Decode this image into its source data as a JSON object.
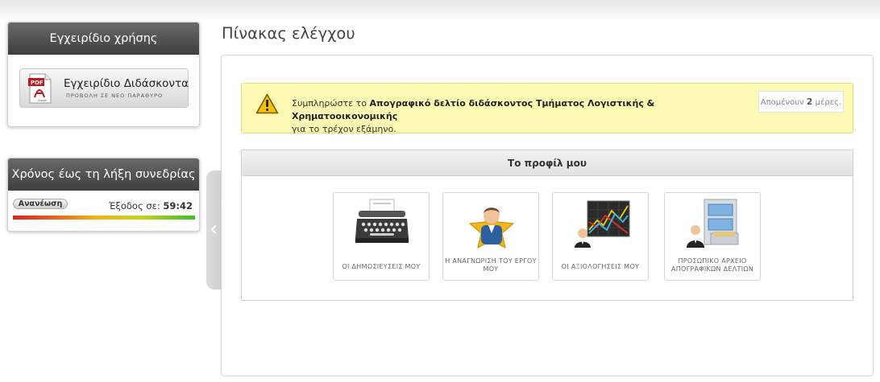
{
  "sidebar": {
    "manual_panel": {
      "title": "Εγχειρίδιο χρήσης",
      "button_title": "Εγχειρίδιο Διδάσκοντα",
      "button_subtitle": "ΠΡΟΒΟΛΗ ΣΕ ΝΕΟ ΠΑΡΑΘΥΡΟ",
      "pdf_label": "PDF",
      "pdf_brand": "Adobe"
    },
    "session_panel": {
      "title": "Χρόνος έως τη λήξη συνεδρίας",
      "refresh_label": "Ανανέωση",
      "exit_prefix": "Έξοδος σε:",
      "exit_time": "59:42"
    },
    "collapse_glyph": "‹"
  },
  "main": {
    "page_title": "Πίνακας ελέγχου",
    "alert": {
      "text_prefix": "Συμπληρώστε το ",
      "text_bold": "Απογραφικό δελτίο διδάσκοντος Τμήματος Λογιστικής & Χρηματοοικονομικής",
      "text_suffix": "για το τρέχον εξάμηνο.",
      "days_prefix": "Απομένουν ",
      "days_value": "2",
      "days_suffix": " μέρες.",
      "icon": "warning-icon"
    },
    "profile": {
      "title": "Το προφίλ μου",
      "tiles": [
        {
          "label": "ΟΙ ΔΗΜΟΣΙΕΥΣΕΙΣ ΜΟΥ",
          "icon": "typewriter-icon"
        },
        {
          "label": "Η ΑΝΑΓΝΩΡΙΣΗ ΤΟΥ ΕΡΓΟΥ ΜΟΥ",
          "icon": "award-star-person-icon"
        },
        {
          "label": "ΟΙ ΑΞΙΟΛΟΓΗΣΕΙΣ ΜΟΥ",
          "icon": "chart-board-person-icon"
        },
        {
          "label": "ΠΡΟΣΩΠΙΚΟ ΑΡΧΕΙΟ ΑΠΟΓΡΑΦΙΚΩΝ ΔΕΛΤΙΩΝ",
          "icon": "file-cabinet-person-icon"
        }
      ]
    }
  },
  "colors": {
    "panel_header": "#4a4a4a",
    "alert_bg": "#fcf9b4",
    "progress_start": "#d9261c",
    "progress_end": "#3cc02c"
  }
}
